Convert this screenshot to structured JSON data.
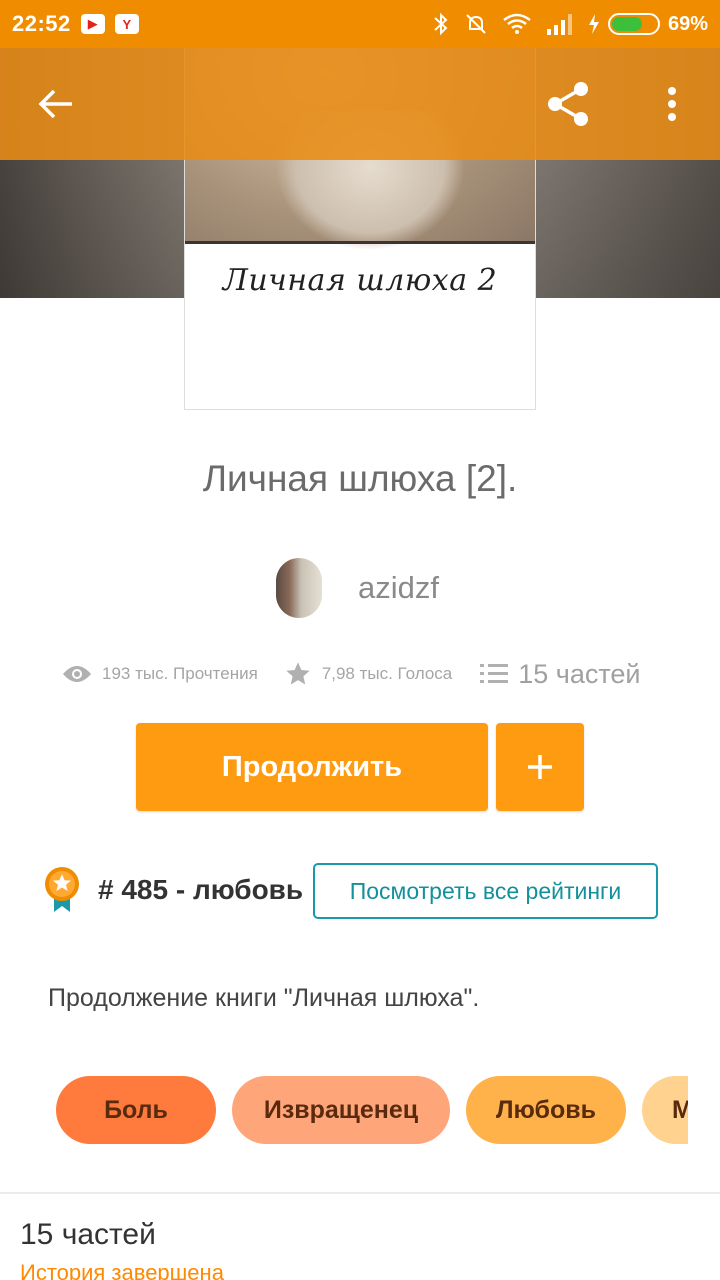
{
  "status_bar": {
    "time": "22:52",
    "app1": "▶",
    "app2": "Y",
    "battery_pct": "69%",
    "battery_level": 0.69,
    "battery_color": "#3cc03c"
  },
  "toolbar": {
    "back_icon": "arrow-left-icon",
    "share_icon": "share-icon",
    "more_icon": "more-vertical-icon",
    "color": "#e88c14"
  },
  "cover": {
    "title_text": "Личная шлюха 2"
  },
  "story": {
    "title": "Личная шлюха [2].",
    "author": "azidzf"
  },
  "stats": {
    "reads": "193 тыс. Прочтения",
    "votes": "7,98 тыс. Голоса",
    "parts": "15 частей"
  },
  "actions": {
    "continue_label": "Продолжить",
    "add_icon": "plus-icon",
    "accent": "#ff9b10"
  },
  "ranking": {
    "text": "# 485 - любовь",
    "view_all_label": "Посмотреть все рейтинги",
    "outline_color": "#1a9aa8"
  },
  "description": "Продолжение книги \"Личная шлюха\".",
  "tags": [
    {
      "label": "Боль"
    },
    {
      "label": "Извращенец"
    },
    {
      "label": "Любовь"
    },
    {
      "label": "М"
    }
  ],
  "parts_section": {
    "title": "15 частей",
    "status": "История завершена"
  }
}
